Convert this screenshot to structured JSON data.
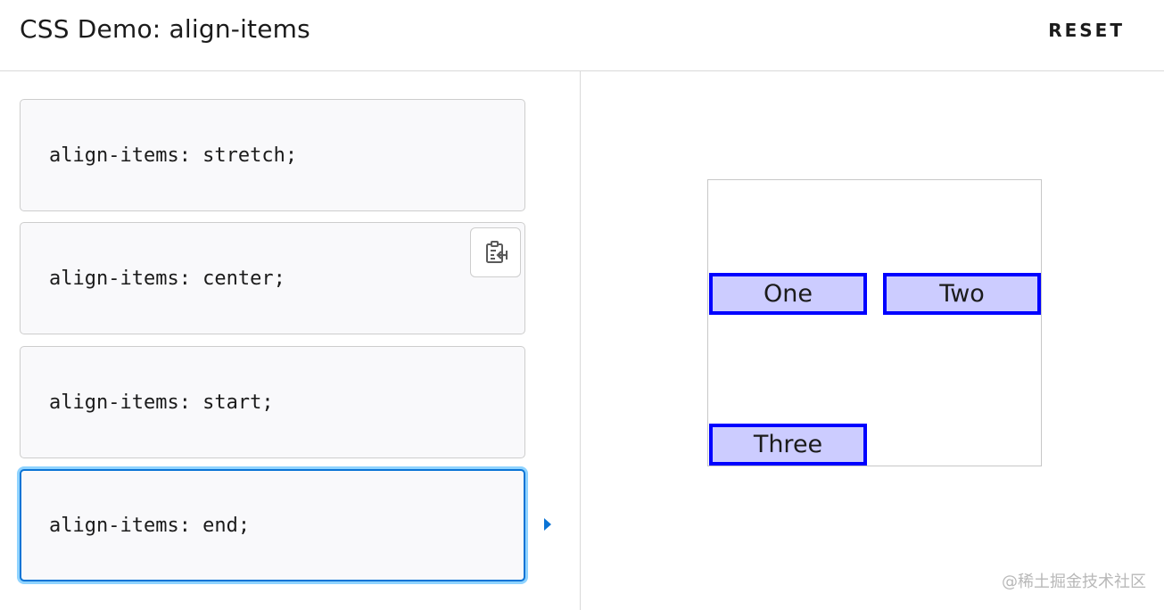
{
  "header": {
    "title": "CSS Demo: align-items",
    "reset_label": "RESET"
  },
  "choices": [
    {
      "code": "align-items: stretch;"
    },
    {
      "code": "align-items: center;"
    },
    {
      "code": "align-items: start;"
    },
    {
      "code": "align-items: end;"
    }
  ],
  "selected_choice": "align-items: end;",
  "output": {
    "items": [
      "One",
      "Two",
      "Three"
    ]
  },
  "watermark": "@稀土掘金技术社区",
  "colors": {
    "accent": "#0b74d5",
    "selection_glow": "#8fd3ff",
    "item_bg": "#ccccff",
    "item_border": "#0000ff"
  },
  "icons": {
    "copy": "clipboard-copy-icon",
    "indicator": "caret-right-icon"
  }
}
